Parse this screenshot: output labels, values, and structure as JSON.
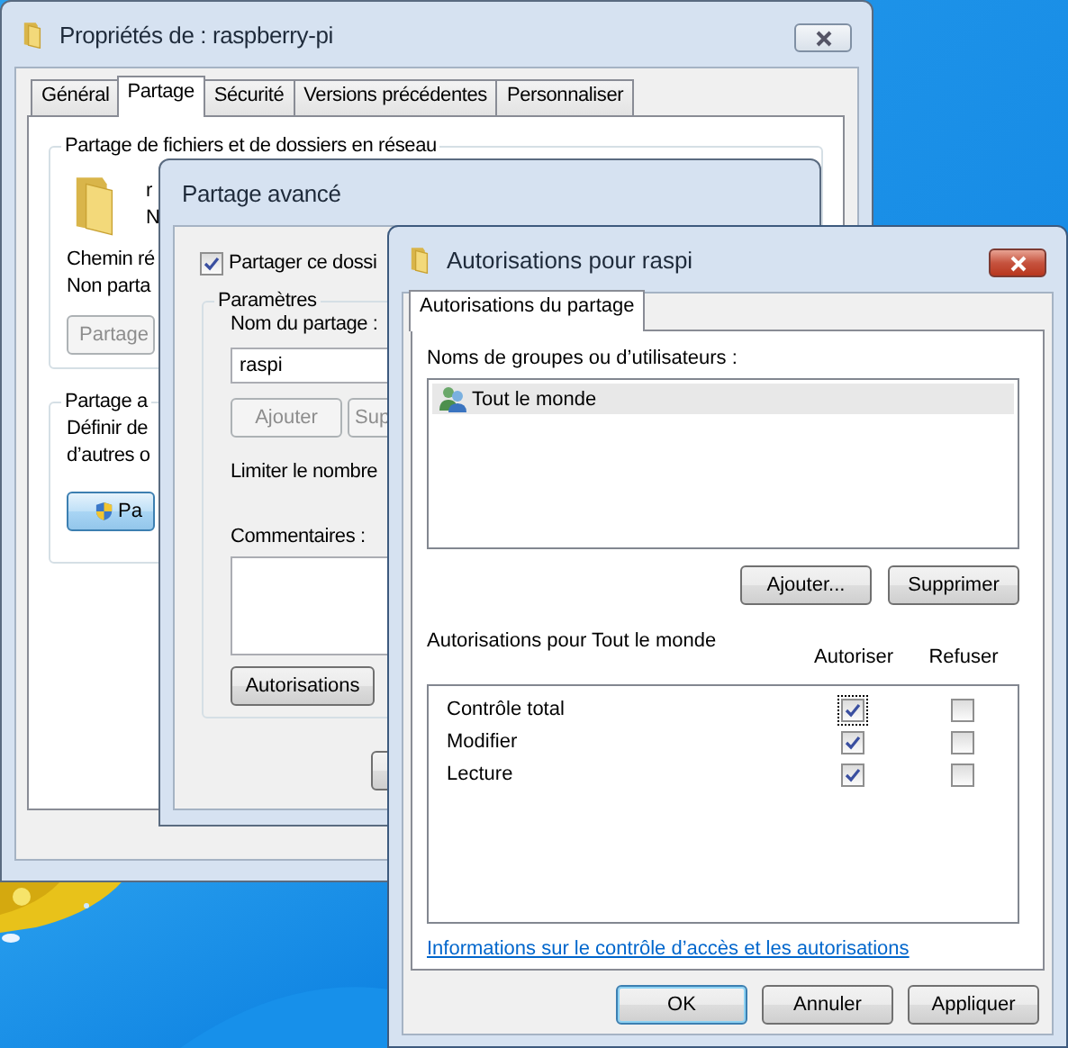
{
  "properties_window": {
    "title": "Propriétés de : raspberry-pi",
    "tabs": [
      {
        "label": "Général",
        "selected": false
      },
      {
        "label": "Partage",
        "selected": true
      },
      {
        "label": "Sécurité",
        "selected": false
      },
      {
        "label": "Versions précédentes",
        "selected": false
      },
      {
        "label": "Personnaliser",
        "selected": false
      }
    ],
    "network_sharing": {
      "legend": "Partage de fichiers et de dossiers en réseau",
      "folder_name": "r",
      "folder_status": "N",
      "path_label": "Chemin ré",
      "path_value": "Non parta",
      "share_button": {
        "label": "Partage",
        "disabled": true
      }
    },
    "advanced_sharing": {
      "legend": "Partage a",
      "description": [
        "Définir de",
        "d’autres o"
      ],
      "button": {
        "label": "Pa",
        "disabled": false
      }
    }
  },
  "advanced_window": {
    "title": "Partage avancé",
    "share_checkbox": {
      "label": "Partager ce dossi",
      "checked": true
    },
    "settings": {
      "legend": "Paramètres",
      "share_name_label": "Nom du partage :",
      "share_name": "raspi",
      "add_button": {
        "label": "Ajouter",
        "disabled": true
      },
      "remove_button": {
        "label": "Sup",
        "disabled": true
      },
      "limit_label": "Limiter le nombre",
      "comments_label": "Commentaires :",
      "permissions_button": "Autorisations"
    }
  },
  "permissions_window": {
    "title": "Autorisations pour raspi",
    "tabs": [
      {
        "label": "Autorisations du partage",
        "selected": true
      }
    ],
    "users_label": "Noms de groupes ou d’utilisateurs :",
    "users": [
      {
        "name": "Tout le monde",
        "selected": true
      }
    ],
    "add_button": "Ajouter...",
    "remove_button": "Supprimer",
    "permissions_label": "Autorisations pour Tout le monde",
    "columns": [
      "Autoriser",
      "Refuser"
    ],
    "permissions": [
      {
        "name": "Contrôle total",
        "allow": true,
        "deny": false,
        "focused": true
      },
      {
        "name": "Modifier",
        "allow": true,
        "deny": false,
        "focused": false
      },
      {
        "name": "Lecture",
        "allow": true,
        "deny": false,
        "focused": false
      }
    ],
    "help_link": "Informations sur le contrôle d’accès et les autorisations",
    "buttons": [
      {
        "label": "OK",
        "default": true
      },
      {
        "label": "Annuler",
        "default": false
      },
      {
        "label": "Appliquer",
        "default": false
      }
    ]
  }
}
